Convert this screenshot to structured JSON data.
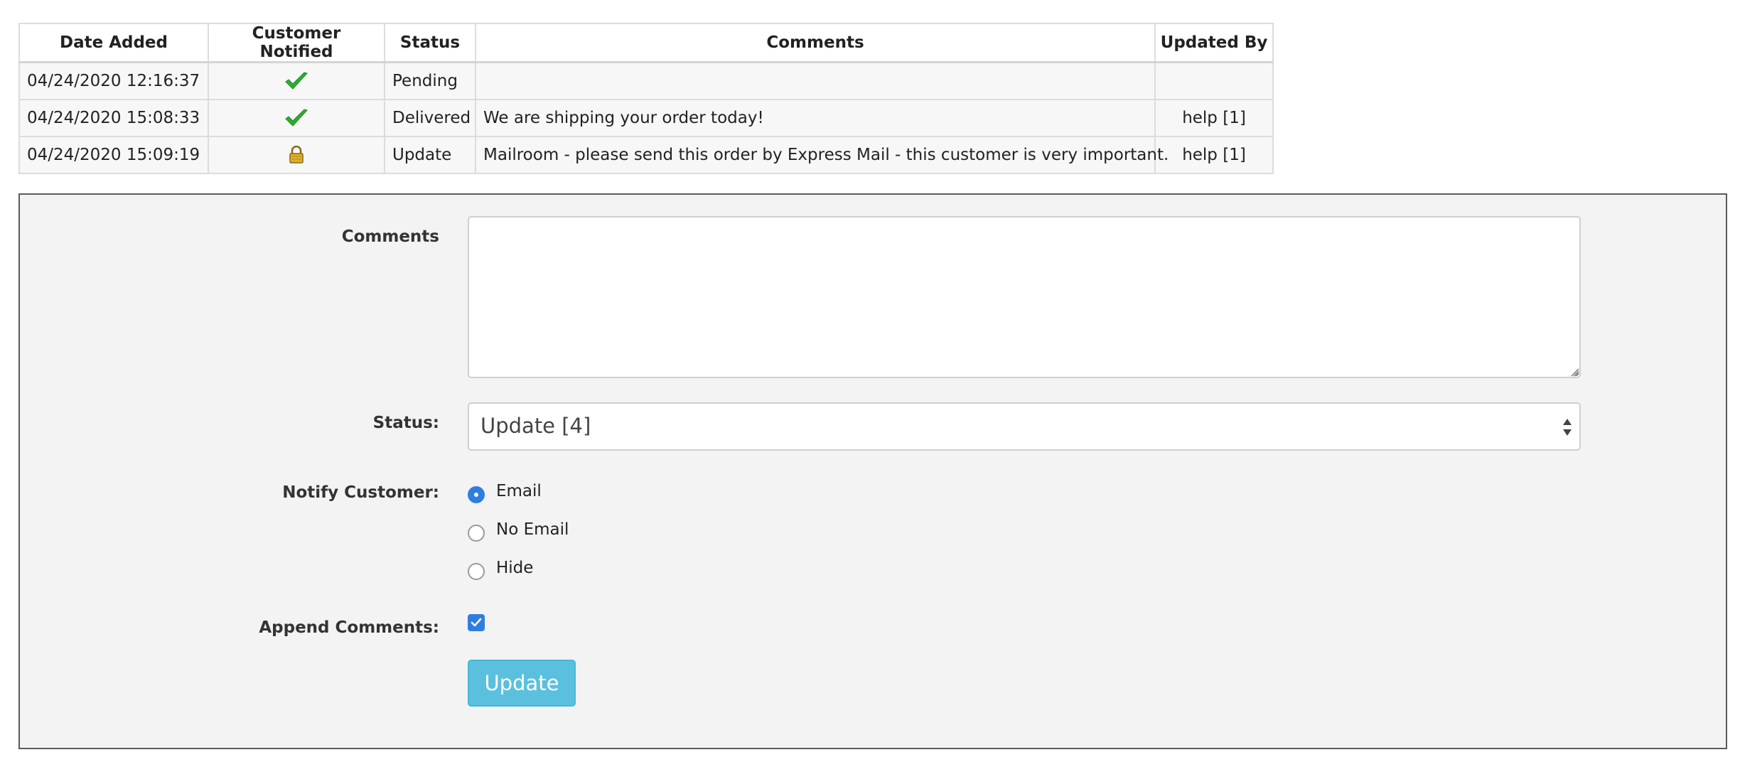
{
  "history": {
    "headers": {
      "date_added": "Date Added",
      "customer_notified": "Customer Notified",
      "status": "Status",
      "comments": "Comments",
      "updated_by": "Updated By"
    },
    "rows": [
      {
        "date": "04/24/2020 12:16:37",
        "notified_icon": "check-icon",
        "status": "Pending",
        "comment": "",
        "updated_by": ""
      },
      {
        "date": "04/24/2020 15:08:33",
        "notified_icon": "check-icon",
        "status": "Delivered",
        "comment": "We are shipping your order today!",
        "updated_by": "help [1]"
      },
      {
        "date": "04/24/2020 15:09:19",
        "notified_icon": "lock-icon",
        "status": "Update",
        "comment": "Mailroom - please send this order by Express Mail - this customer is very important.",
        "updated_by": "help [1]"
      }
    ]
  },
  "form": {
    "comments_label": "Comments",
    "comments_value": "",
    "status_label": "Status:",
    "status_selected": "Update [4]",
    "notify_label": "Notify Customer:",
    "notify_options": [
      {
        "label": "Email",
        "checked": true
      },
      {
        "label": "No Email",
        "checked": false
      },
      {
        "label": "Hide",
        "checked": false
      }
    ],
    "append_label": "Append Comments:",
    "append_checked": true,
    "update_button": "Update"
  },
  "colors": {
    "accent_blue": "#2f7de1",
    "button_info": "#5bc0de",
    "check_green": "#2fae2f",
    "lock_gold": "#d9a821"
  }
}
